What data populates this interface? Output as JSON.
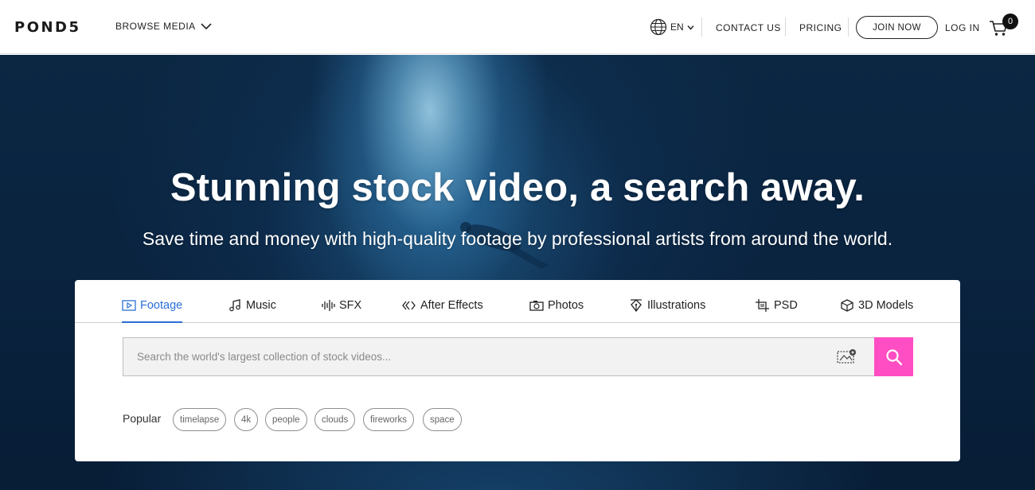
{
  "header": {
    "logo": "POND5",
    "browse_label": "BROWSE MEDIA",
    "language": "EN",
    "contact_label": "CONTACT US",
    "pricing_label": "PRICING",
    "join_label": "JOIN NOW",
    "login_label": "LOG IN",
    "cart_count": "0"
  },
  "hero": {
    "headline": "Stunning stock video, a search away.",
    "subline": "Save time and money with high-quality footage by professional artists from around the world."
  },
  "search": {
    "tabs": [
      {
        "label": "Footage",
        "icon": "play-icon",
        "active": true
      },
      {
        "label": "Music",
        "icon": "music-note-icon"
      },
      {
        "label": "SFX",
        "icon": "waveform-icon"
      },
      {
        "label": "After Effects",
        "icon": "after-effects-icon"
      },
      {
        "label": "Photos",
        "icon": "camera-icon"
      },
      {
        "label": "Illustrations",
        "icon": "pen-nib-icon"
      },
      {
        "label": "PSD",
        "icon": "crop-icon"
      },
      {
        "label": "3D Models",
        "icon": "cube-icon"
      }
    ],
    "placeholder": "Search the world's largest collection of stock videos...",
    "popular_label": "Popular",
    "popular_tags": [
      "timelapse",
      "4k",
      "people",
      "clouds",
      "fireworks",
      "space"
    ]
  },
  "colors": {
    "accent_blue": "#2a6fd6",
    "search_button": "#ff4dc3",
    "hero_dark": "#0b2742"
  }
}
